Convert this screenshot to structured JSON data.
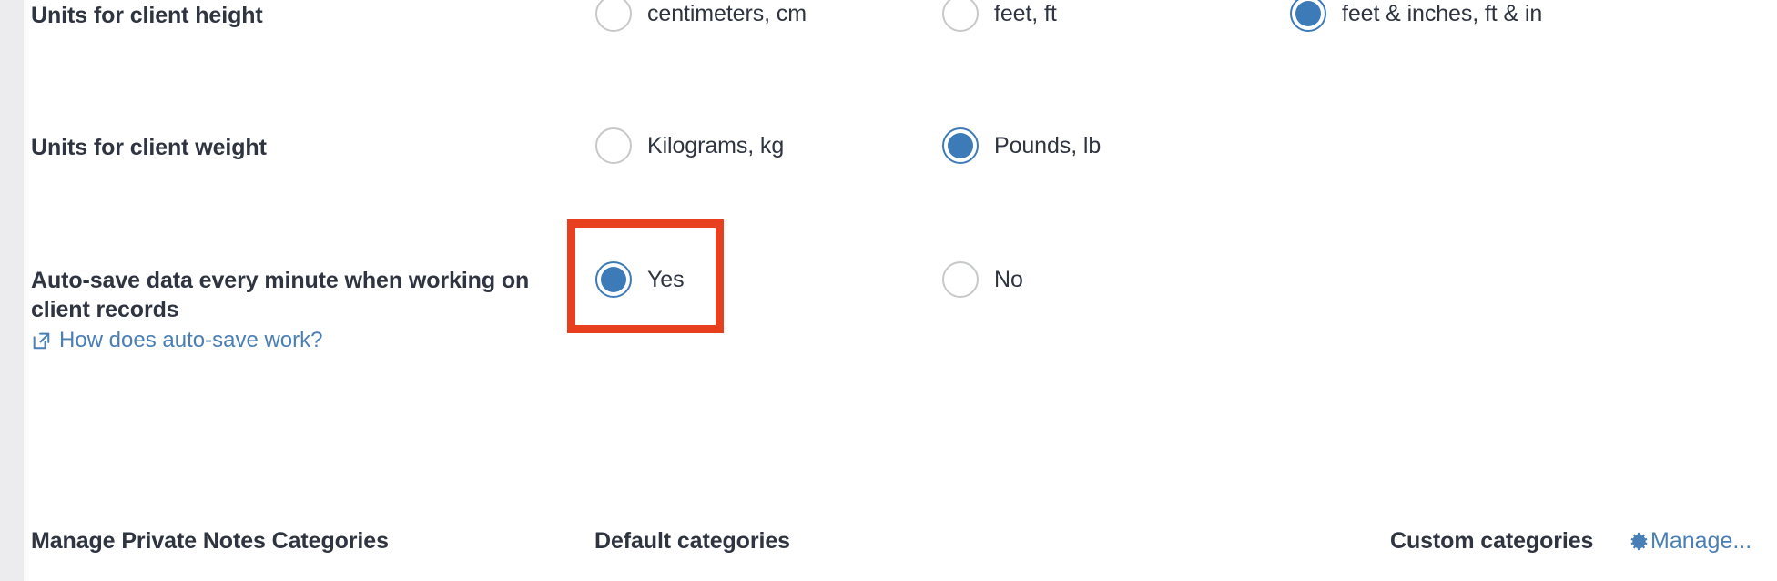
{
  "settings": {
    "rows": [
      {
        "id": "client-height",
        "label": "Units for client height",
        "options": [
          {
            "label": "centimeters, cm",
            "selected": false
          },
          {
            "label": "feet, ft",
            "selected": false
          },
          {
            "label": "feet & inches, ft & in",
            "selected": true
          }
        ]
      },
      {
        "id": "client-weight",
        "label": "Units for client weight",
        "options": [
          {
            "label": "Kilograms, kg",
            "selected": false
          },
          {
            "label": "Pounds, lb",
            "selected": true
          }
        ]
      },
      {
        "id": "auto-save",
        "label": "Auto-save data every minute when working on client records",
        "help_link": "How does auto-save work?",
        "help_icon": "external-link-icon",
        "options": [
          {
            "label": "Yes",
            "selected": true
          },
          {
            "label": "No",
            "selected": false
          }
        ]
      }
    ],
    "private_notes": {
      "title": "Manage Private Notes Categories",
      "default_categories_label": "Default categories",
      "custom_categories_label": "Custom categories",
      "manage_label": "Manage...",
      "manage_icon": "gear-icon"
    },
    "colors": {
      "accent_blue": "#3d7ab8",
      "link_blue": "#4a7fb5",
      "annotation_red": "#e8401f",
      "text_dark": "#2e3440",
      "radio_border_off": "#c6c8ca"
    }
  }
}
